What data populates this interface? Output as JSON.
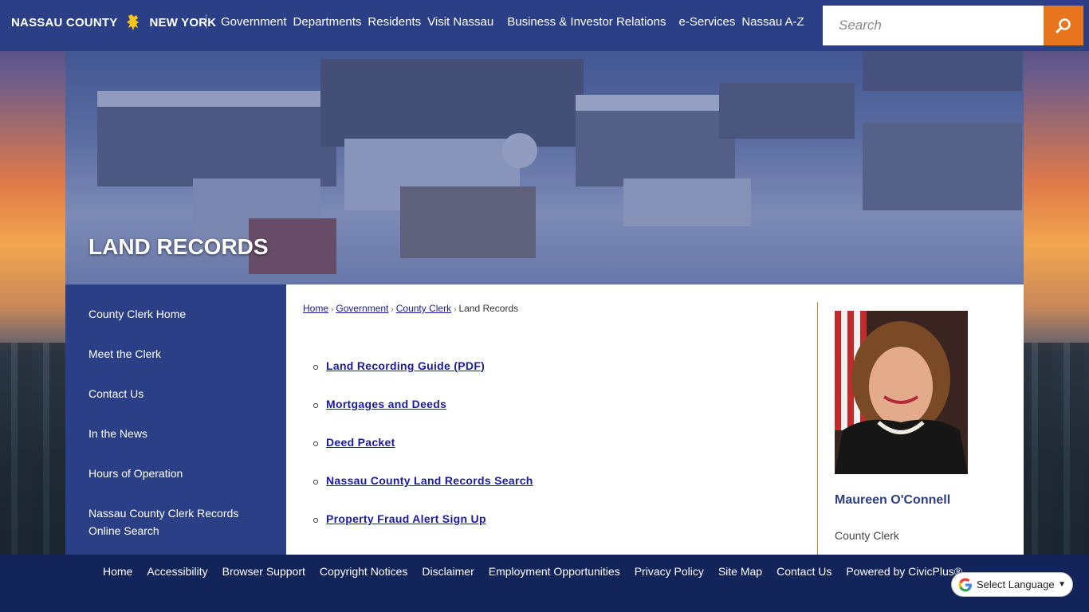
{
  "header": {
    "logo_left": "NASSAU COUNTY",
    "logo_right": "NEW YORK",
    "nav": [
      "Government",
      "Departments",
      "Residents",
      "Visit Nassau",
      "Business & Investor Relations",
      "e-Services",
      "Nassau A-Z"
    ],
    "search_placeholder": "Search"
  },
  "banner": {
    "title": "LAND RECORDS"
  },
  "sidebar": {
    "items": [
      {
        "label": "County Clerk Home"
      },
      {
        "label": "Meet the Clerk"
      },
      {
        "label": "Contact Us"
      },
      {
        "label": "In the News"
      },
      {
        "label": "Hours of Operation"
      },
      {
        "label": "Nassau County Clerk Records Online Search"
      }
    ]
  },
  "breadcrumb": {
    "items": [
      "Home",
      "Government",
      "County Clerk"
    ],
    "current": "Land Records",
    "separator": "›"
  },
  "content": {
    "links": [
      {
        "label": "Land Recording Guide (PDF)"
      },
      {
        "label": "Mortgages and Deeds"
      },
      {
        "label": "Deed Packet"
      },
      {
        "label": "Nassau County Land Records Search"
      },
      {
        "label": "Property Fraud Alert Sign Up"
      }
    ]
  },
  "profile": {
    "name": "Maureen O'Connell",
    "title": "County Clerk"
  },
  "footer": {
    "links": [
      "Home",
      "Accessibility",
      "Browser Support",
      "Copyright Notices",
      "Disclaimer",
      "Employment Opportunities",
      "Privacy Policy",
      "Site Map",
      "Contact Us",
      "Powered by CivicPlus®"
    ]
  },
  "language": {
    "label": "Select Language"
  },
  "colors": {
    "navy": "#2b3f86",
    "footer": "#12245a",
    "accent": "#e8741e",
    "link": "#1a1aa6"
  },
  "icons": {
    "search": "search-icon",
    "logo": "lion-icon",
    "google": "google-icon"
  }
}
